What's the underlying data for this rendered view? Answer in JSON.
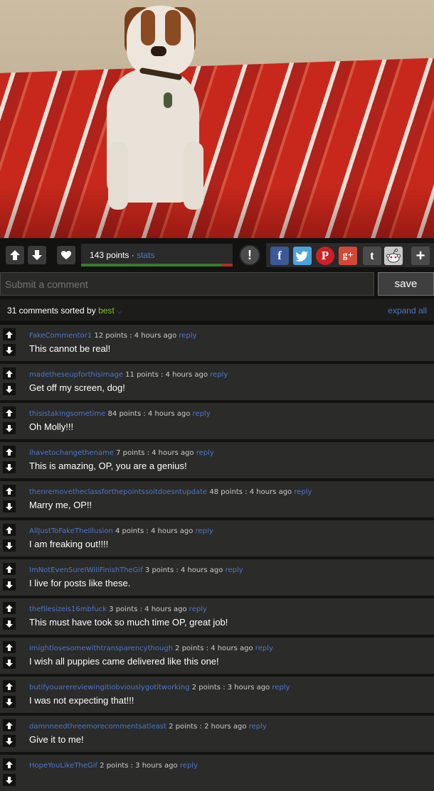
{
  "post": {
    "points_label": "143 points",
    "separator": " · ",
    "stats_label": "stats",
    "upvote_ratio": 0.925,
    "report_label": "!"
  },
  "share": [
    {
      "name": "facebook",
      "glyph": "f",
      "color": "#3b5998"
    },
    {
      "name": "twitter",
      "glyph": "t",
      "color": "#4aa3df"
    },
    {
      "name": "pinterest",
      "glyph": "P",
      "color": "#cb2027"
    },
    {
      "name": "googleplus",
      "glyph": "g+",
      "color": "#d34836"
    },
    {
      "name": "tumblr",
      "glyph": "t",
      "color": "#4a4a4a"
    },
    {
      "name": "reddit",
      "glyph": "",
      "color": "#c9c9c9"
    },
    {
      "name": "more",
      "glyph": "+",
      "color": "#4a4a4a"
    }
  ],
  "submit": {
    "placeholder": "Submit a comment",
    "save_label": "save"
  },
  "comments_header": {
    "count_label": "31 comments sorted by",
    "sort_label": "best",
    "expand_label": "expand all"
  },
  "comments": [
    {
      "author": "FakeCommentor1",
      "points": "12 points",
      "time": "4 hours ago",
      "reply": "reply",
      "text": "This cannot be real!"
    },
    {
      "author": "madetheseupforthisimage",
      "points": "11 points",
      "time": "4 hours ago",
      "reply": "reply",
      "text": "Get off my screen, dog!"
    },
    {
      "author": "thisistakingsometime",
      "points": "84 points",
      "time": "4 hours ago",
      "reply": "reply",
      "text": "Oh Molly!!!"
    },
    {
      "author": "ihavetochangethename",
      "points": "7 points",
      "time": "4 hours ago",
      "reply": "reply",
      "text": "This is amazing, OP, you are a genius!"
    },
    {
      "author": "thenremovetheclassforthepointssoitdoesntupdate",
      "points": "48 points",
      "time": "4 hours ago",
      "reply": "reply",
      "text": "Marry me, OP!!"
    },
    {
      "author": "AllJustToFakeTheIllusion",
      "points": "4 points",
      "time": "4 hours ago",
      "reply": "reply",
      "text": "I am freaking out!!!!"
    },
    {
      "author": "ImNotEvenSureIWillFinishTheGif",
      "points": "3 points",
      "time": "4 hours ago",
      "reply": "reply",
      "text": "I live for posts like these."
    },
    {
      "author": "thefilesizeis16mbfuck",
      "points": "3 points",
      "time": "4 hours ago",
      "reply": "reply",
      "text": "This must have took so much time OP, great job!"
    },
    {
      "author": "imightlosesomewithtransparencythough",
      "points": "2 points",
      "time": "4 hours ago",
      "reply": "reply",
      "text": "I wish all puppies came delivered like this one!"
    },
    {
      "author": "butifyouarereviewingitiobviouslygotitworking",
      "points": "2 points",
      "time": "3 hours ago",
      "reply": "reply",
      "text": "I was not expecting that!!!"
    },
    {
      "author": "damnneedthreemorecommentsatleast",
      "points": "2 points",
      "time": "2 hours ago",
      "reply": "reply",
      "text": "Give it to me!"
    },
    {
      "author": "HopeYouLikeTheGif",
      "points": "2 points",
      "time": "3 hours ago",
      "reply": "reply",
      "text": ""
    }
  ]
}
